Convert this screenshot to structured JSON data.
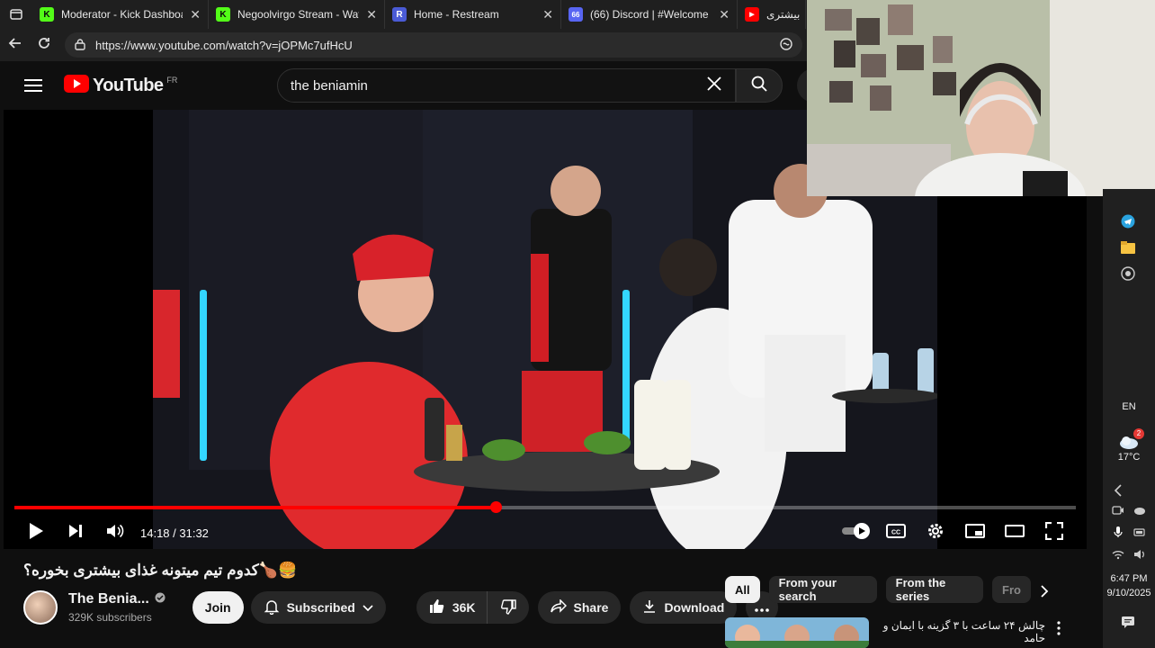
{
  "browser": {
    "tabs": [
      {
        "favicon": "K",
        "favicon_color": "#53fc18",
        "title": "Moderator - Kick Dashboard"
      },
      {
        "favicon": "K",
        "favicon_color": "#53fc18",
        "title": "Negoolvirgo Stream - Watch"
      },
      {
        "favicon": "R",
        "favicon_color": "#4a5bd6",
        "title": "Home - Restream"
      },
      {
        "favicon": "66",
        "favicon_color": "#5865f2",
        "title": "(66) Discord | #Welcome"
      },
      {
        "favicon": "▶",
        "favicon_color": "#ff0000",
        "title": "بیشتری"
      }
    ],
    "url": "https://www.youtube.com/watch?v=jOPMc7ufHcU"
  },
  "youtube": {
    "logo_text": "YouTube",
    "region": "FR",
    "search_query": "the beniamin"
  },
  "player": {
    "current_time": "14:18",
    "duration": "31:32",
    "time_display": "14:18 / 31:32",
    "progress_fraction": 0.453
  },
  "video": {
    "title": "🍔🍗کدوم تیم میتونه غذای بیشتری بخوره؟",
    "channel_name": "The Benia...",
    "subscribers": "329K subscribers",
    "join_label": "Join",
    "subscribed_label": "Subscribed",
    "likes": "36K",
    "share_label": "Share",
    "download_label": "Download"
  },
  "recommendations": {
    "chips": [
      "All",
      "From your search",
      "From the series",
      "Fro"
    ],
    "first_title": "چالش ۲۴ ساعت با ۳ گزینه با ایمان و حامد"
  },
  "taskbar": {
    "language": "EN",
    "weather_temp": "17°C",
    "weather_badge": "2",
    "clock_time": "6:47 PM",
    "clock_date": "9/10/2025"
  },
  "colors": {
    "accent": "#ff0000",
    "background": "#0f0f0f",
    "surface": "#272727"
  }
}
